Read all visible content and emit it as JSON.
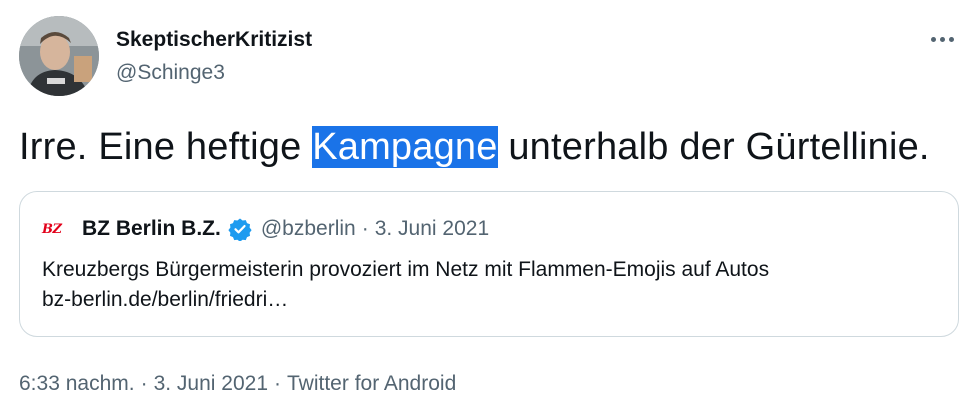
{
  "author": {
    "display_name": "SkeptischerKritizist",
    "handle": "@Schinge3",
    "avatar_icon": "user-photo-avatar"
  },
  "more_icon": "more-horizontal-icon",
  "tweet": {
    "text_before": "Irre. Eine heftige ",
    "text_highlighted": "Kampagne",
    "text_after": " unterhalb der Gürtellinie.",
    "highlight_color": "#1a73e8"
  },
  "quote": {
    "logo_text": "BZ",
    "name": "BZ Berlin B.Z.",
    "verified_icon": "verified-badge-icon",
    "verified_color": "#1d9bf0",
    "handle": "@bzberlin",
    "separator": "·",
    "date": "3. Juni 2021",
    "body": "Kreuzbergs Bürgermeisterin provoziert im Netz mit Flammen-Emojis auf Autos",
    "link": "bz-berlin.de/berlin/friedri…"
  },
  "meta": {
    "time": "6:33 nachm.",
    "separator": "·",
    "date": "3. Juni 2021",
    "source": "Twitter for Android"
  }
}
